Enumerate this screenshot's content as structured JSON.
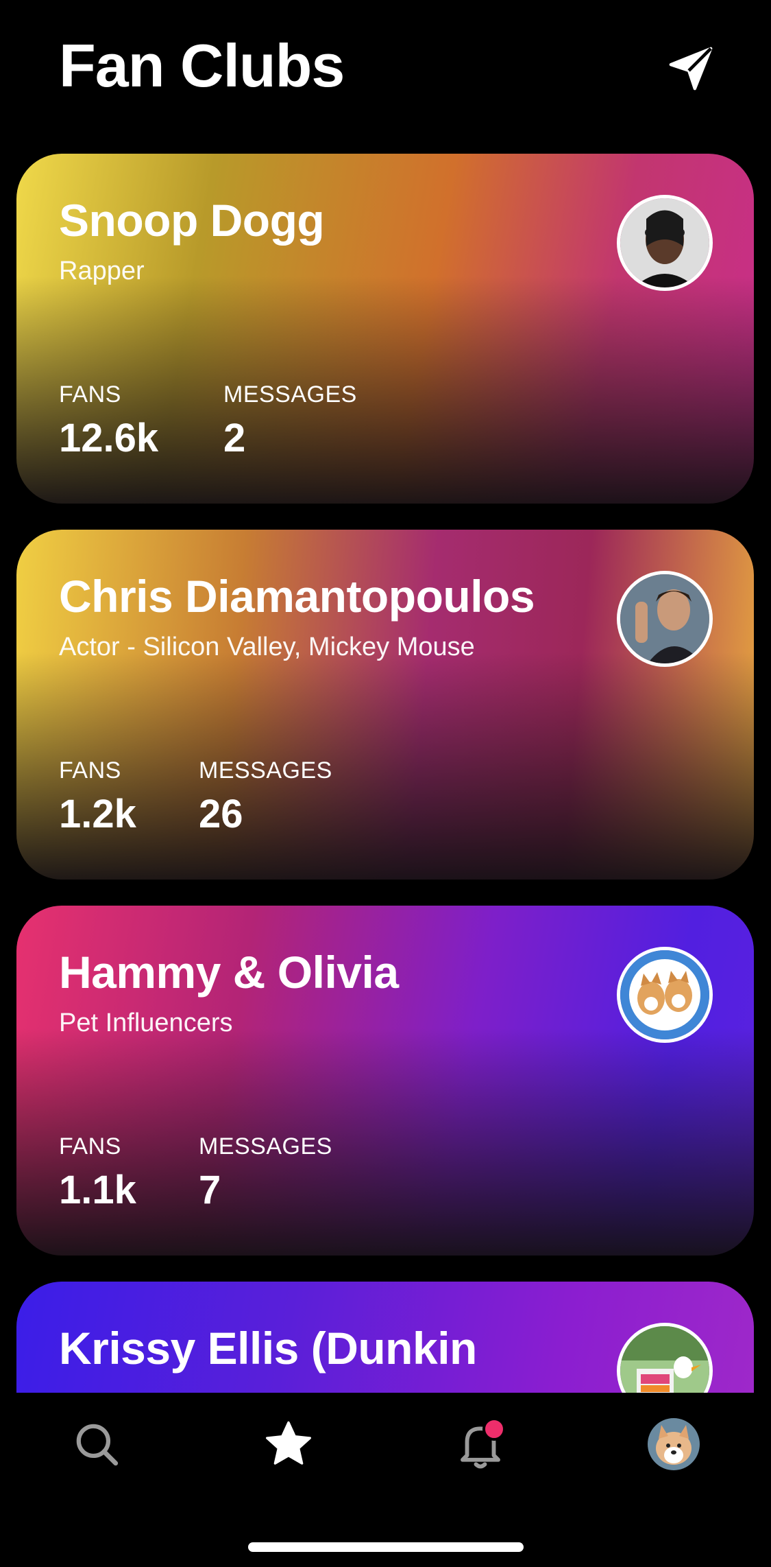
{
  "header": {
    "title": "Fan Clubs",
    "action_icon": "send-icon"
  },
  "cards": [
    {
      "name": "Snoop Dogg",
      "subtitle": "Rapper",
      "fans_label": "FANS",
      "fans": "12.6k",
      "messages_label": "MESSAGES",
      "messages": "2"
    },
    {
      "name": "Chris Diamantopoulos",
      "subtitle": "Actor - Silicon Valley, Mickey Mouse",
      "fans_label": "FANS",
      "fans": "1.2k",
      "messages_label": "MESSAGES",
      "messages": "26"
    },
    {
      "name": "Hammy & Olivia",
      "subtitle": "Pet Influencers",
      "fans_label": "FANS",
      "fans": "1.1k",
      "messages_label": "MESSAGES",
      "messages": "7"
    },
    {
      "name": "Krissy Ellis (Dunkin"
    }
  ],
  "tabbar": {
    "items": [
      {
        "icon": "search-icon",
        "active": false
      },
      {
        "icon": "star-icon",
        "active": true
      },
      {
        "icon": "bell-icon",
        "active": false,
        "badge": true
      },
      {
        "icon": "profile-avatar",
        "active": false
      }
    ],
    "badge_color": "#ee2e6b"
  }
}
